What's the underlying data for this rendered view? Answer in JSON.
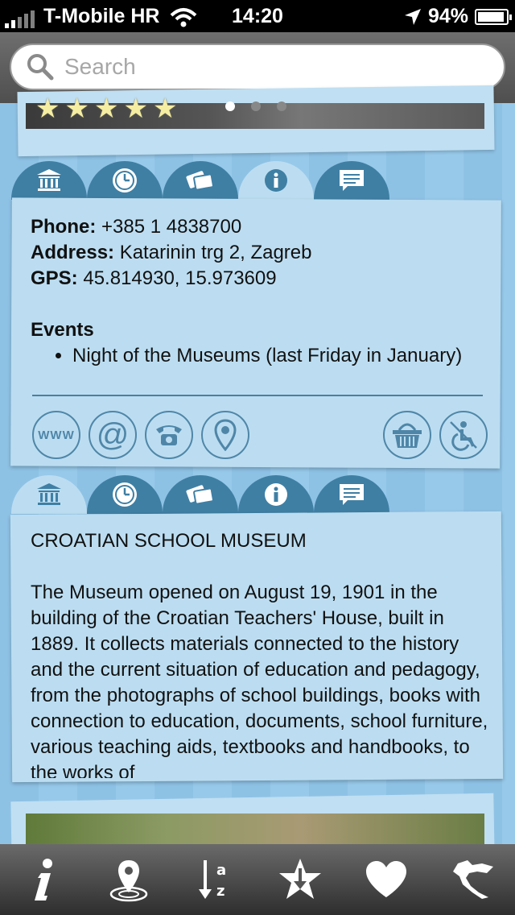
{
  "status_bar": {
    "carrier": "T-Mobile HR",
    "time": "14:20",
    "battery": "94%"
  },
  "search": {
    "placeholder": "Search"
  },
  "rating": {
    "stars": 5
  },
  "tabs": [
    "museum-icon",
    "clock-icon",
    "tickets-icon",
    "info-icon",
    "comment-icon"
  ],
  "info_card": {
    "phone_label": "Phone:",
    "phone": "+385 1 4838700",
    "address_label": "Address:",
    "address": "Katarinin trg 2, Zagreb",
    "gps_label": "GPS:",
    "gps": "45.814930, 15.973609",
    "events_title": "Events",
    "events": [
      "Night of the Museums (last Friday in January)"
    ],
    "www_label": "www",
    "at_label": "@"
  },
  "description_card": {
    "heading": "CROATIAN SCHOOL MUSEUM",
    "text": "The Museum opened on August 19, 1901 in the building of the Croatian Teachers' House, built in 1889. It collects materials connected to the history and the current situation of education and pedagogy, from the photographs of school buildings, books with connection to education, documents, school furniture, various teaching aids, textbooks and handbooks, to the works of"
  },
  "toolbar": [
    "info-icon",
    "map-pin-icon",
    "sort-az-icon",
    "star-download-icon",
    "heart-icon",
    "croatia-map-icon"
  ],
  "colors": {
    "tab": "#3f7fa4",
    "card": "#bcddf1",
    "accent": "#4f86a8"
  }
}
